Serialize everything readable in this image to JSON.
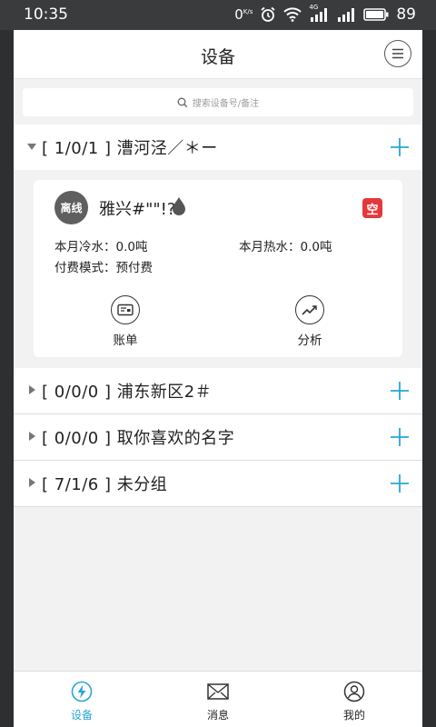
{
  "status_bar": {
    "time": "10:35",
    "net_speed": "0",
    "net_unit": "K/s",
    "network_type": "4G",
    "battery": "89"
  },
  "header": {
    "title": "设备"
  },
  "search": {
    "placeholder": "搜索设备号/备注"
  },
  "groups": [
    {
      "label": "[ 1/0/1 ] 漕河泾／＊ー",
      "expanded": true
    },
    {
      "label": "[ 0/0/0 ] 浦东新区2＃",
      "expanded": false
    },
    {
      "label": "[ 0/0/0 ] 取你喜欢的名字",
      "expanded": false
    },
    {
      "label": "[ 7/1/6 ] 未分组",
      "expanded": false
    }
  ],
  "device_card": {
    "status_badge": "离线",
    "name": "雅兴#\"\"!?",
    "empty_badge": "空",
    "cold_water": "本月冷水：0.0吨",
    "hot_water": "本月热水：0.0吨",
    "payment_mode": "付费模式：预付费",
    "actions": [
      {
        "label": "账单"
      },
      {
        "label": "分析"
      }
    ]
  },
  "tabbar": {
    "tabs": [
      {
        "label": "设备",
        "active": true
      },
      {
        "label": "消息",
        "active": false
      },
      {
        "label": "我的",
        "active": false
      }
    ]
  },
  "colors": {
    "accent": "#2aa5d6",
    "danger": "#e5383b",
    "avatar_bg": "#5f5f5f"
  }
}
